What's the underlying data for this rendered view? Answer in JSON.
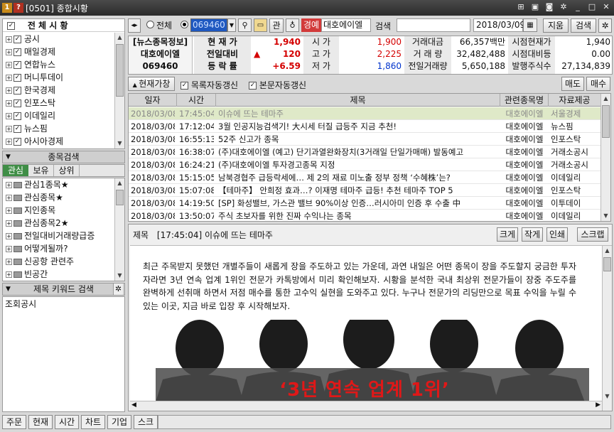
{
  "window": {
    "badge1": "1",
    "badge2": "?",
    "title": "[0501] 종합시황"
  },
  "left": {
    "all_label": "전 체 시 황",
    "sources": [
      "공시",
      "매일경제",
      "연합뉴스",
      "머니투데이",
      "한국경제",
      "인포스탁",
      "이데일리",
      "뉴스핌",
      "아시아경제"
    ],
    "stock_search_title": "종목검색",
    "tabs": [
      "관심",
      "보유",
      "상위"
    ],
    "groups": [
      "관심1종목★",
      "관심종목★",
      "지인종목",
      "관심종목2★",
      "전일대비거래량급증",
      "어떻게될까?",
      "신공항 관련주",
      "빈공간"
    ],
    "keyword_title": "제목 키워드 검색",
    "keyword_value": "조회공시"
  },
  "toolbar": {
    "radio_all": "전체",
    "code": "069460",
    "btn_kwan": "관",
    "warn": "경예",
    "stock_name": "대호에이엘",
    "search_label": "검색",
    "date": "2018/03/09",
    "erase": "지움",
    "search_btn": "검색"
  },
  "quote": {
    "info_label": "[뉴스종목정보]",
    "name": "대호에이엘",
    "code": "069460",
    "cur_label": "현 재 가",
    "cur": "1,940",
    "diff_label": "전일대비",
    "diff_arrow": "▲",
    "diff": "120",
    "rate_label": "등 락 률",
    "rate": "+6.59",
    "open_label": "시 가",
    "open": "1,900",
    "high_label": "고 가",
    "high": "2,225",
    "low_label": "저 가",
    "low": "1,860",
    "amt_label": "거래대금",
    "amt": "66,357백만",
    "vol_label": "거 래 량",
    "vol": "32,482,488",
    "pvol_label": "전일거래량",
    "pvol": "5,650,188",
    "mcap_label": "시점현재가",
    "mcap": "1,940",
    "mrate_label": "시점대비등",
    "mrate": "0.00",
    "shares_label": "발행주식수",
    "shares": "27,134,839"
  },
  "options": {
    "cur_btn": "현재가창",
    "auto_list": "목록자동갱신",
    "auto_body": "본문자동갱신",
    "sell": "매도",
    "buy": "매수"
  },
  "news": {
    "headers": [
      "일자",
      "시간",
      "제목",
      "관련종목명",
      "자료제공"
    ],
    "rows": [
      [
        "2018/03/08",
        "17:45:04",
        "이슈에 뜨는 테마주",
        "대호에이엘",
        "서울경제"
      ],
      [
        "2018/03/08",
        "17:12:04",
        "3월 인공지능검색기! 大시세 터질 급등주 지금 추천!",
        "대호에이엘",
        "뉴스핌"
      ],
      [
        "2018/03/08",
        "16:55:13",
        "52주 신고가 종목",
        "대호에이엘",
        "인포스탁"
      ],
      [
        "2018/03/08",
        "16:38:07",
        "(주)대호에이엘 (예고) 단기과열완화장치(3거래일 단일가매매) 발동예고",
        "대호에이엘",
        "거래소공시"
      ],
      [
        "2018/03/08",
        "16:24:21",
        "(주)대호에이엘 투자경고종목 지정",
        "대호에이엘",
        "거래소공시"
      ],
      [
        "2018/03/08",
        "15:15:05",
        "남북경협주 급등락세에… 제 2의 재료 미노출 정부 정책 ‘수혜株’는?",
        "대호에이엘",
        "이데일리"
      ],
      [
        "2018/03/08",
        "15:07:08",
        "【테마주】 안희정 효과…? 이재명 테마주 급등! 추천 테마주 TOP 5",
        "대호에이엘",
        "인포스탁"
      ],
      [
        "2018/03/08",
        "14:19:50",
        "[SP] 화성밸브, 가스관 밸브 90%이상 인증…러시아미 인증 후 수출 中",
        "대호에이엘",
        "이투데이"
      ],
      [
        "2018/03/08",
        "13:50:07",
        "주식 초보자를 위한 진짜 수익나는 종목",
        "대호에이엘",
        "이데일리"
      ]
    ]
  },
  "article": {
    "label": "제목",
    "title": "[17:45:04] 이슈에 뜨는 테마주",
    "btn_big": "크게",
    "btn_small": "작게",
    "btn_print": "인쇄",
    "btn_scrap": "스크랩",
    "body": "최근 주목받지 못했던 개별주들이 새롭게 장을 주도하고 있는 가운데, 과연 내일은 어떤 종목이 장을 주도할지 궁금한 투자자라면 3년 연속 업계 1위인 전문가 카톡방에서 미리 확인해보자. 시황을 분석한 국내 최상위 전문가들이 장중 주도주를 완벽하게 선취매 하면서 저점 매수를 통한 고수익 실현을 도와주고 있다. 누구나 전문가의 리딩만으로 목표 수익을 누릴 수 있는 이곳, 지금 바로 입장 후 시작해보자.",
    "banner": "‘3년 연속 업계 1위’"
  },
  "bottom_tabs": [
    "주문",
    "현재",
    "시간",
    "차트",
    "기업",
    "스크"
  ]
}
